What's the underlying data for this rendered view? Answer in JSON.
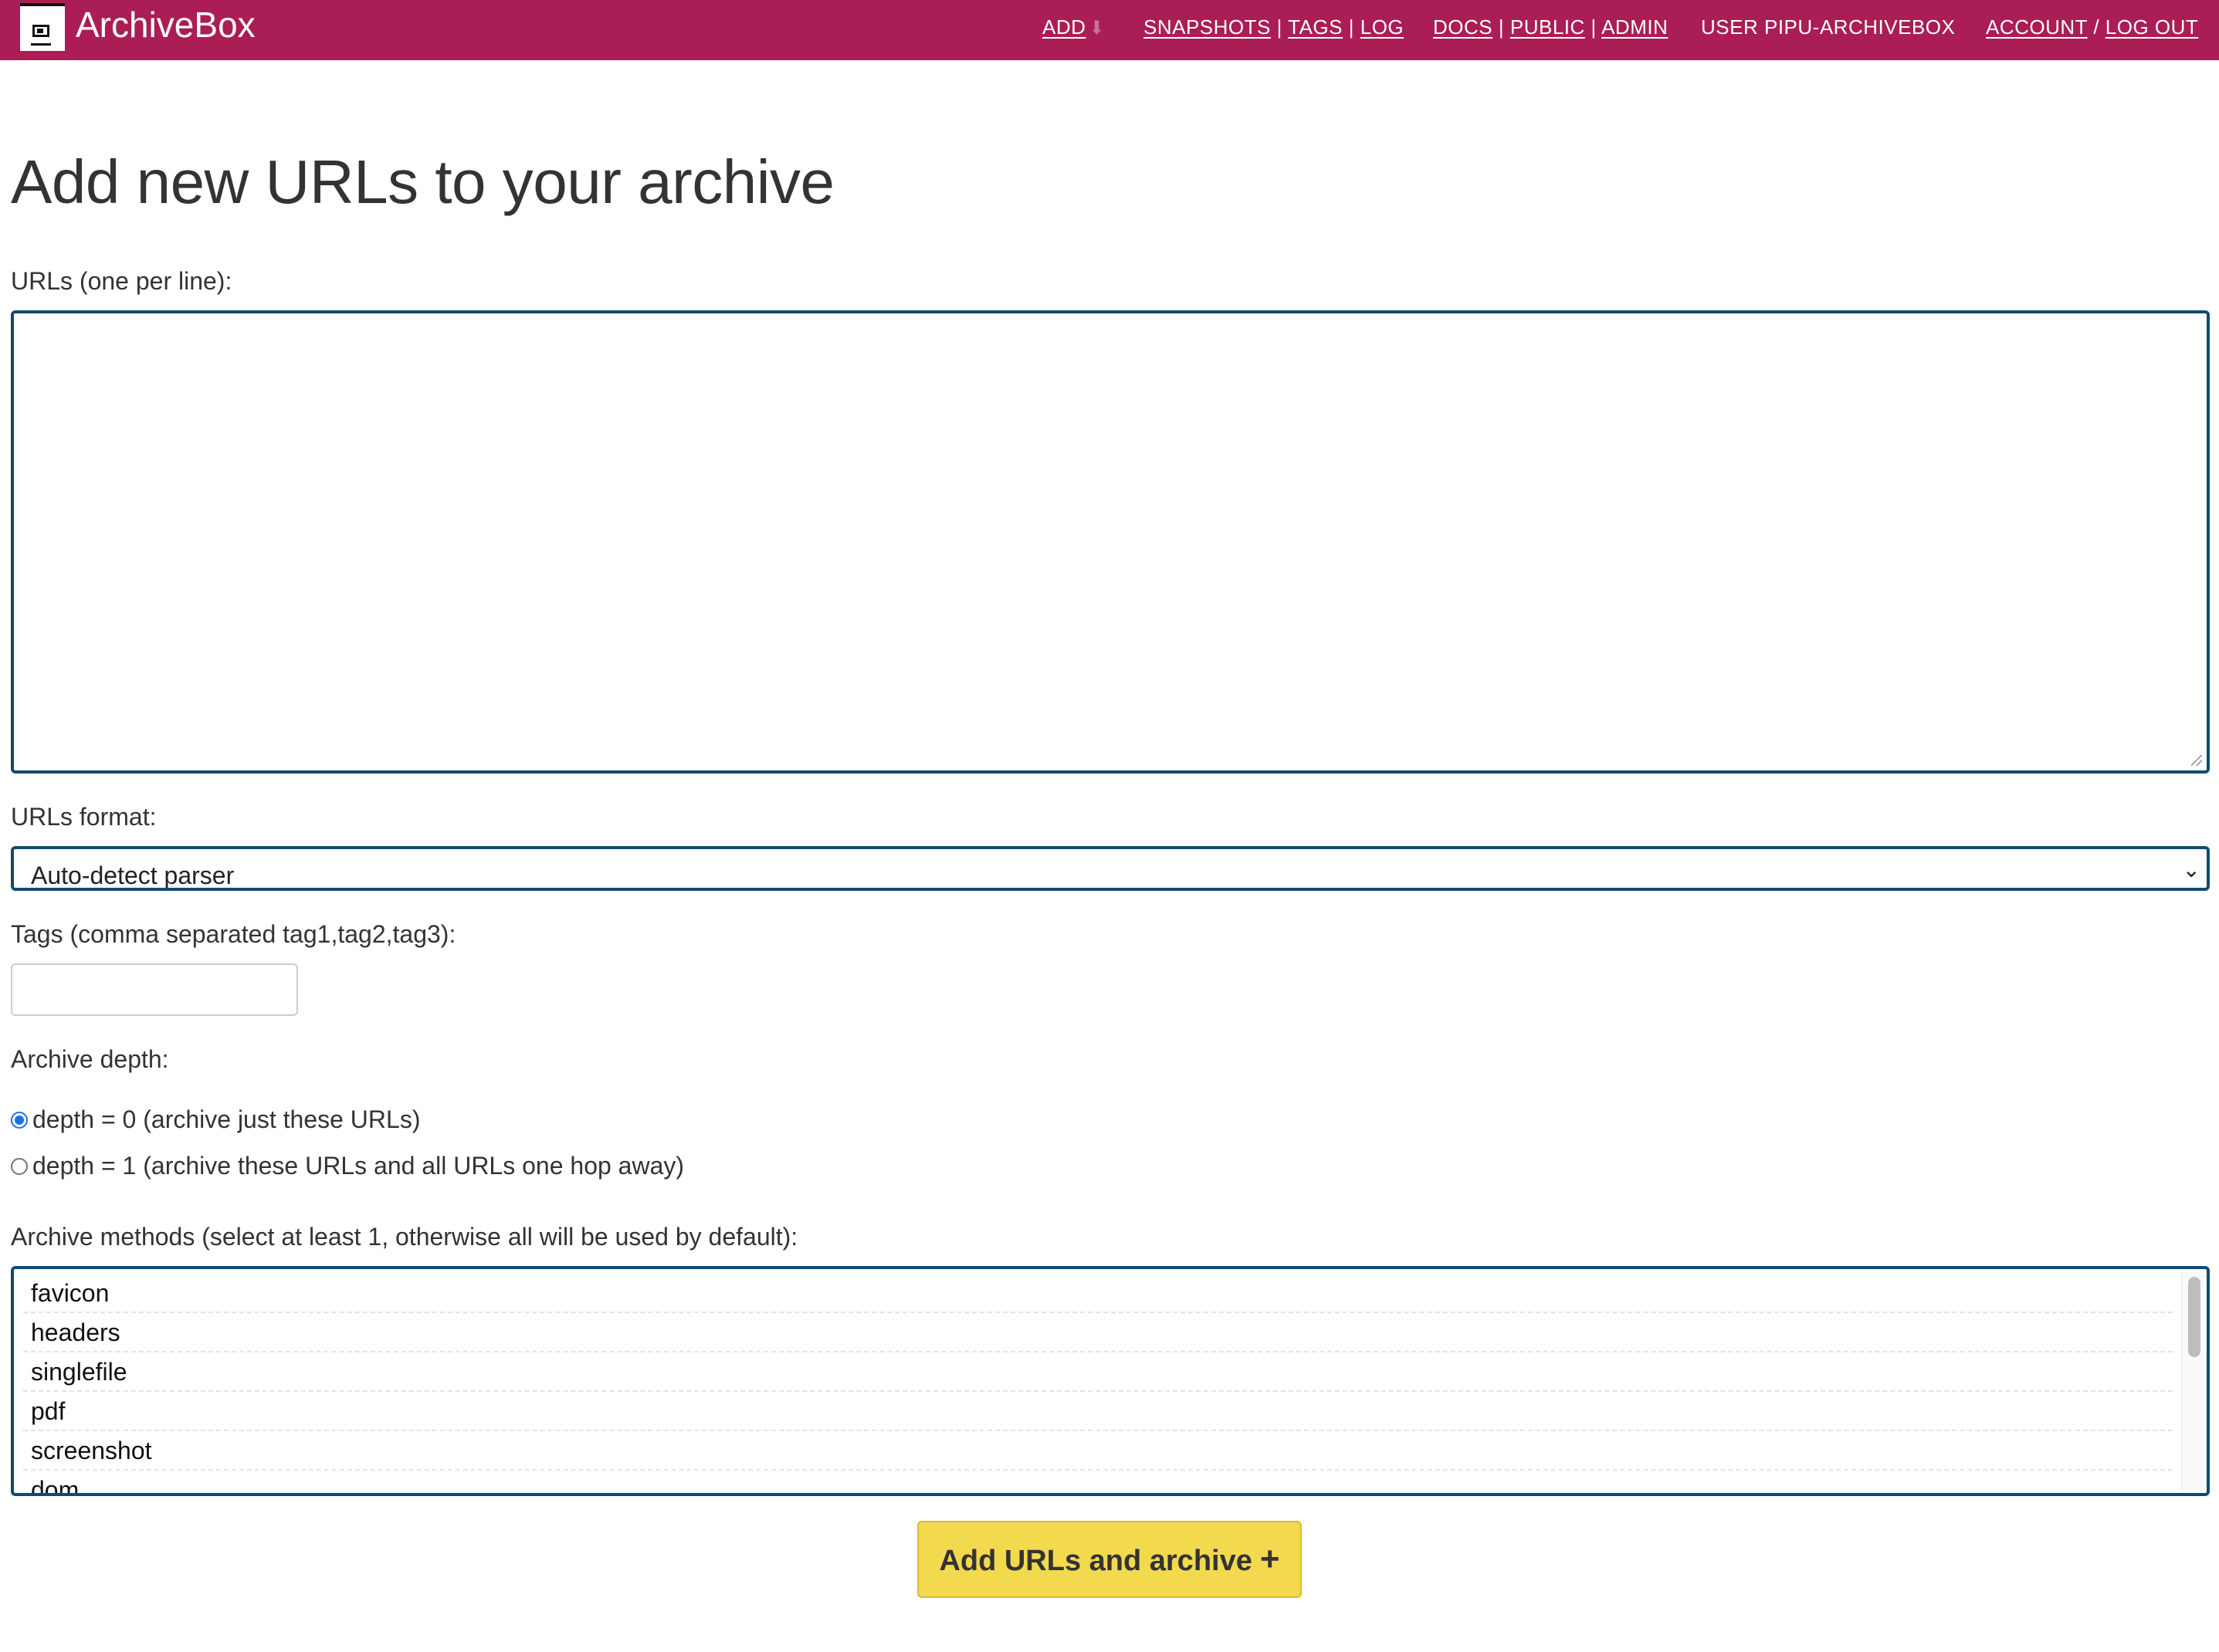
{
  "header": {
    "brand": "ArchiveBox",
    "logo_icon": "archivebox-logo-icon",
    "nav": {
      "add": "ADD",
      "add_icon": "download-icon",
      "snapshots": "SNAPSHOTS",
      "tags": "TAGS",
      "log": "LOG",
      "docs": "DOCS",
      "public": "PUBLIC",
      "admin": "ADMIN",
      "user_prefix": "USER",
      "user_name": "PIPU-ARCHIVEBOX",
      "account": "ACCOUNT",
      "logout": "LOG OUT",
      "sep": "|",
      "slash": "/"
    },
    "colors": {
      "bar": "#aa1e55",
      "text": "#ffffff"
    }
  },
  "main": {
    "title": "Add new URLs to your archive",
    "urls_label": "URLs (one per line):",
    "urls_value": "",
    "format_label": "URLs format:",
    "format_value": "Auto-detect parser",
    "tags_label": "Tags (comma separated tag1,tag2,tag3):",
    "tags_value": "",
    "depth_label": "Archive depth:",
    "depth_options": [
      {
        "label": "depth = 0 (archive just these URLs)",
        "checked": true
      },
      {
        "label": "depth = 1 (archive these URLs and all URLs one hop away)",
        "checked": false
      }
    ],
    "methods_label": "Archive methods (select at least 1, otherwise all will be used by default):",
    "methods": [
      "favicon",
      "headers",
      "singlefile",
      "pdf",
      "screenshot",
      "dom"
    ],
    "submit_label": "Add URLs and archive",
    "submit_icon": "+",
    "colors": {
      "accent_border": "#124a6e",
      "submit_bg": "#f2d94e"
    }
  }
}
